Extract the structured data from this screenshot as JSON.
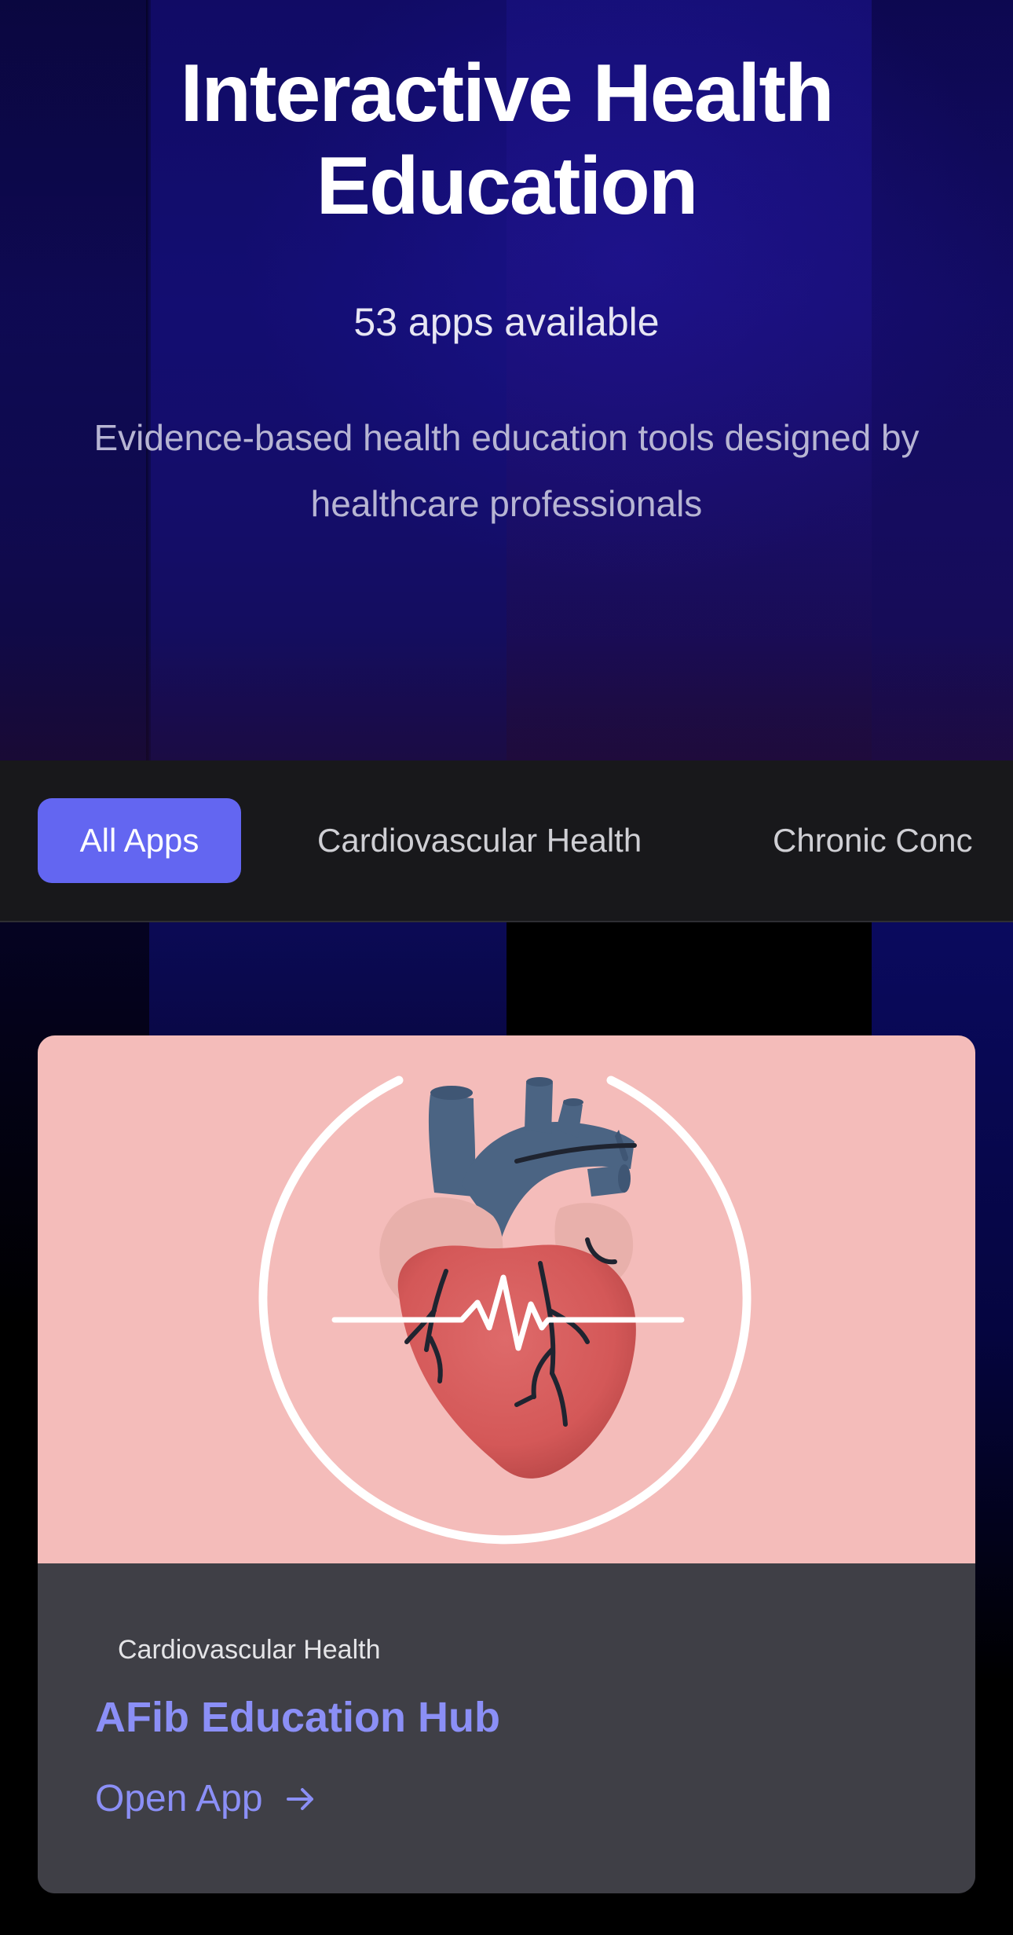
{
  "hero": {
    "title": "Interactive Health Education",
    "app_count": "53 apps available",
    "description": "Evidence-based health education tools designed by healthcare professionals"
  },
  "filters": {
    "items": [
      {
        "label": "All Apps",
        "active": true
      },
      {
        "label": "Cardiovascular Health",
        "active": false
      },
      {
        "label": "Chronic Conc",
        "active": false
      }
    ]
  },
  "app_card": {
    "image_icon": "heart-with-heartbeat-illustration",
    "category": "Cardiovascular Health",
    "title": "AFib Education Hub",
    "link_label": "Open App",
    "link_icon": "arrow-right-icon"
  },
  "colors": {
    "accent": "#6366f1",
    "link": "#8b8ff6",
    "card_bg": "#3f3f46",
    "card_image_bg": "#f4bcba",
    "filter_bar_bg": "#18181b",
    "hero_bg": "#130d72"
  }
}
